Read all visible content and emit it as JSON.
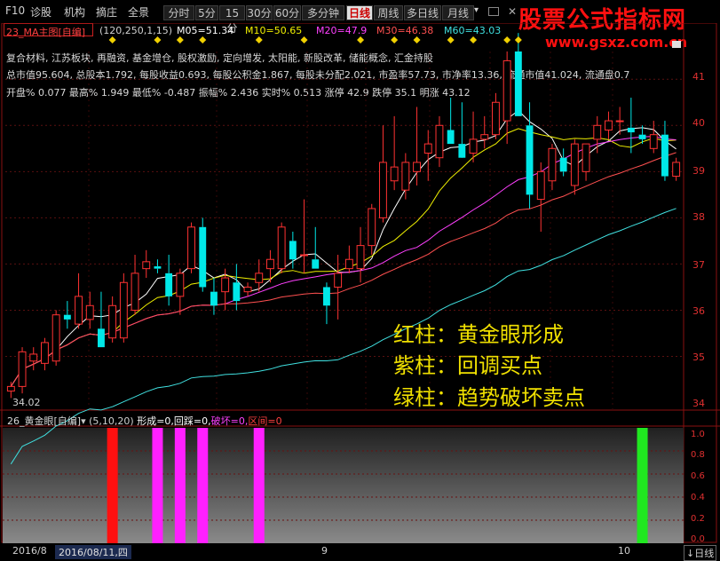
{
  "menu": {
    "f10": "F10",
    "diagnose": "诊股",
    "institution": "机构",
    "excerpt": "摘庄",
    "fullscreen": "全景",
    "periods": [
      "分时",
      "5分",
      "15分",
      "30分",
      "60分",
      "多分钟",
      "日线",
      "周线",
      "多日线",
      "月线"
    ],
    "active_period": "日线",
    "dropdown_glyph": "▾"
  },
  "brand": {
    "title": "股票公式指标网",
    "url": "www.gsxz.com.cn"
  },
  "main_indicator": {
    "name": "23_MA主图[自编]",
    "params": "(120,250,1,15)",
    "ma05": "M05=51.34",
    "ma10": "M10=50.65",
    "ma20": "M20=47.9",
    "ma30": "M30=46.38",
    "ma60": "M60=43.03"
  },
  "stock_info": {
    "concepts": "复合材料, 江苏板块, 再融资, 基金增仓, 股权激励, 定向增发, 太阳能, 新股改革, 储能概念, 汇金持股",
    "line2": "总市值95.604, 总股本1.792, 每股收益0.693, 每股公积金1.867, 每股未分配2.021, 市盈率57.73, 市净率13.36, 流通市值41.024, 流通盘0.7",
    "line3": "开盘% 0.077  最高% 1.949  最低% -0.487  振幅% 2.436  实时% 0.513  涨停 42.9  跌停 35.1  明涨 43.12"
  },
  "price_axis": [
    "41",
    "40",
    "39",
    "38",
    "37",
    "36",
    "35",
    "34"
  ],
  "low_marker": "34.02",
  "legend": {
    "red": "红柱：黄金眼形成",
    "purple": "紫柱：回调买点",
    "green": "绿柱：趋势破坏卖点"
  },
  "sub_indicator": {
    "name": "26_黄金眼[自编]",
    "params": "(5,10,20)",
    "formed": "形成=0,",
    "pullback": "回踩=0,",
    "broken": "破坏=0,",
    "interval": "区间=0"
  },
  "sub_axis": [
    "1.0",
    "0.8",
    "0.6",
    "0.4",
    "0.2",
    "0.0"
  ],
  "bottom": {
    "month_label": "2016/8",
    "date_label": "2016/08/11,四",
    "mark_9": "9",
    "mark_10": "10",
    "period_switch": "↓日线"
  },
  "colors": {
    "up": "#ff3232",
    "down": "#00e8e8",
    "ma5": "#ffffff",
    "ma10": "#f0f000",
    "ma20": "#ff40ff",
    "ma30": "#ff5050",
    "ma60": "#40e0e0"
  },
  "chart_data": {
    "type": "candlestick",
    "ylim": [
      33.8,
      41.6
    ],
    "candles": [
      [
        34.25,
        34.45,
        34.1,
        34.35
      ],
      [
        34.35,
        35.2,
        34.2,
        35.1
      ],
      [
        34.9,
        35.2,
        34.7,
        35.05
      ],
      [
        34.85,
        35.4,
        34.7,
        35.3
      ],
      [
        34.9,
        36.0,
        34.8,
        35.9
      ],
      [
        35.9,
        36.2,
        35.6,
        35.8
      ],
      [
        35.7,
        36.8,
        35.6,
        36.3
      ],
      [
        35.8,
        36.4,
        35.6,
        36.1
      ],
      [
        35.6,
        36.4,
        35.2,
        35.2
      ],
      [
        35.4,
        36.3,
        35.3,
        36.1
      ],
      [
        35.4,
        36.8,
        35.3,
        36.6
      ],
      [
        36.0,
        37.2,
        35.9,
        36.8
      ],
      [
        36.9,
        37.3,
        36.7,
        37.05
      ],
      [
        36.95,
        37.1,
        36.8,
        36.9
      ],
      [
        36.8,
        37.2,
        36.1,
        36.3
      ],
      [
        36.3,
        36.9,
        35.9,
        36.8
      ],
      [
        36.9,
        37.9,
        36.8,
        37.8
      ],
      [
        37.8,
        38.0,
        36.4,
        36.5
      ],
      [
        36.4,
        36.7,
        35.9,
        36.1
      ],
      [
        36.4,
        36.9,
        36.0,
        36.7
      ],
      [
        36.6,
        37.0,
        36.0,
        36.2
      ],
      [
        36.4,
        36.6,
        36.3,
        36.5
      ],
      [
        36.6,
        37.1,
        36.4,
        36.8
      ],
      [
        36.9,
        37.3,
        36.6,
        37.1
      ],
      [
        36.9,
        37.9,
        36.8,
        37.8
      ],
      [
        37.5,
        37.7,
        36.9,
        37.1
      ],
      [
        37.2,
        38.4,
        36.8,
        37.2
      ],
      [
        37.1,
        37.8,
        36.9,
        36.9
      ],
      [
        36.5,
        36.6,
        35.7,
        36.1
      ],
      [
        36.5,
        37.2,
        35.8,
        36.8
      ],
      [
        36.9,
        37.4,
        36.8,
        37.1
      ],
      [
        36.9,
        37.8,
        36.6,
        37.4
      ],
      [
        37.4,
        38.3,
        37.2,
        38.2
      ],
      [
        38.0,
        40.0,
        37.9,
        39.2
      ],
      [
        38.8,
        40.2,
        38.6,
        39.1
      ],
      [
        38.6,
        39.4,
        38.4,
        39.2
      ],
      [
        39.0,
        40.4,
        38.7,
        39.2
      ],
      [
        39.4,
        39.9,
        38.8,
        39.6
      ],
      [
        39.3,
        40.2,
        39.1,
        40.0
      ],
      [
        39.9,
        40.6,
        39.6,
        39.6
      ],
      [
        39.6,
        40.5,
        39.4,
        39.3
      ],
      [
        39.4,
        40.3,
        39.2,
        39.7
      ],
      [
        39.7,
        40.2,
        39.5,
        39.8
      ],
      [
        39.8,
        40.7,
        39.7,
        40.5
      ],
      [
        40.1,
        41.6,
        39.6,
        41.4
      ],
      [
        41.6,
        42.0,
        40.2,
        40.2
      ],
      [
        40.0,
        40.5,
        38.2,
        38.5
      ],
      [
        38.4,
        39.2,
        37.7,
        39.0
      ],
      [
        38.8,
        39.6,
        38.6,
        39.5
      ],
      [
        39.3,
        39.5,
        38.9,
        39.0
      ],
      [
        38.7,
        39.7,
        38.5,
        39.6
      ],
      [
        39.0,
        39.6,
        38.8,
        39.6
      ],
      [
        39.7,
        40.2,
        39.4,
        40.0
      ],
      [
        39.9,
        40.3,
        39.7,
        40.1
      ],
      [
        40.1,
        40.4,
        39.8,
        40.1
      ],
      [
        39.95,
        40.6,
        39.4,
        39.85
      ],
      [
        39.8,
        40.0,
        39.6,
        39.7
      ],
      [
        39.5,
        40.1,
        39.4,
        39.8
      ],
      [
        39.8,
        40.1,
        38.8,
        38.9
      ],
      [
        38.9,
        39.3,
        38.8,
        39.2
      ]
    ],
    "signals": [
      {
        "index": 9,
        "type": "red"
      },
      {
        "index": 13,
        "type": "purple"
      },
      {
        "index": 15,
        "type": "purple"
      },
      {
        "index": 17,
        "type": "purple"
      },
      {
        "index": 22,
        "type": "purple"
      },
      {
        "index": 56,
        "type": "green"
      }
    ]
  }
}
